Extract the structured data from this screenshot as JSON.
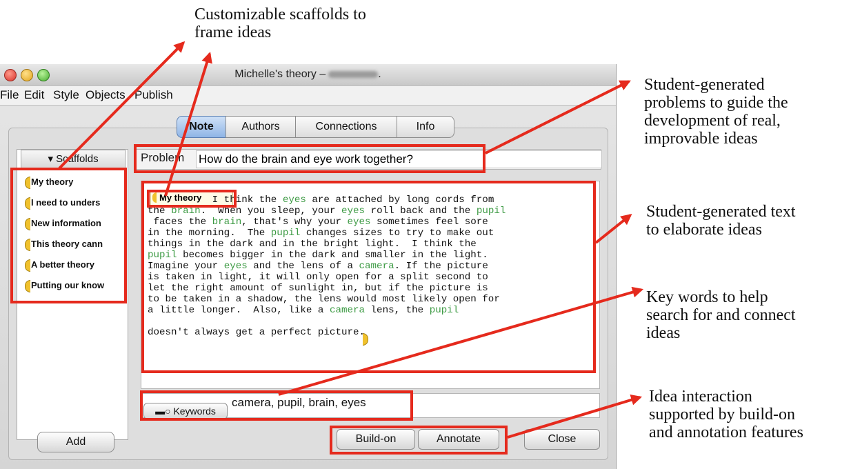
{
  "window": {
    "title": "Michelle's theory –",
    "title_suffix": "."
  },
  "menu": [
    "File",
    "Edit",
    "Style",
    "Objects",
    "Publish"
  ],
  "tabs": [
    "Note",
    "Authors",
    "Connections",
    "Info"
  ],
  "scaffolds": {
    "header": "▾ Scaffolds",
    "items": [
      "My theory",
      "I need to unders",
      "New information",
      "This theory cann",
      "A better theory",
      "Putting our know"
    ],
    "add_label": "Add"
  },
  "problem": {
    "label": "Problem",
    "value": "How do the brain and eye work together?"
  },
  "note": {
    "scaffold_tag": "My theory",
    "keywords_highlight": [
      "eyes",
      "brain",
      "pupil",
      "camera"
    ],
    "lines": [
      "           I think the eyes are attached by long cords from",
      "the brain.  When you sleep, your eyes roll back and the pupil",
      " faces the brain, that's why your eyes sometimes feel sore",
      "in the morning.  The pupil changes sizes to try to make out",
      "things in the dark and in the bright light.  I think the",
      "pupil becomes bigger in the dark and smaller in the light.",
      "Imagine your eyes and the lens of a camera. If the picture",
      "is taken in light, it will only open for a split second to",
      "let the right amount of sunlight in, but if the picture is",
      "to be taken in a shadow, the lens would most likely open for",
      "a little longer.  Also, like a camera lens, the pupil",
      "",
      "doesn't always get a perfect picture."
    ]
  },
  "keywords": {
    "button_label": "Keywords",
    "value": "camera, pupil, brain, eyes"
  },
  "buttons": {
    "buildon": "Build-on",
    "annotate": "Annotate",
    "close": "Close"
  },
  "annotations": {
    "scaffolds": [
      "Customizable scaffolds to",
      "frame ideas"
    ],
    "problems": [
      "Student-generated",
      "problems to guide the",
      "development of real,",
      "improvable ideas"
    ],
    "text": [
      "Student-generated text",
      "to elaborate ideas"
    ],
    "keywords": [
      "Key words to help",
      "search for and connect",
      "ideas"
    ],
    "interaction": [
      "Idea interaction",
      "supported by build-on",
      "and annotation features"
    ]
  },
  "colors": {
    "annotation_red": "#e52a1d",
    "keyword_green": "#3c9a43",
    "scaffold_gold": "#f0c12d"
  }
}
